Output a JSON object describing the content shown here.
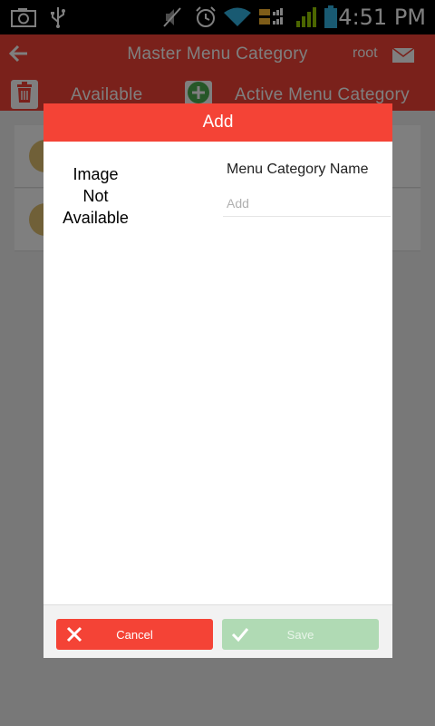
{
  "status_bar": {
    "time": "4:51 PM",
    "icons": [
      "camera-icon",
      "usb-icon",
      "mute-icon",
      "alarm-icon",
      "wifi-icon",
      "evdo-icon",
      "signal-icon",
      "battery-icon"
    ]
  },
  "app_bar": {
    "title": "Master Menu Category",
    "user": "root",
    "tab_available": "Available",
    "tab_active": "Active Menu Category"
  },
  "dialog": {
    "title": "Add",
    "image_placeholder": "Image\nNot\nAvailable",
    "field_label": "Menu Category Name",
    "field_placeholder": "Add",
    "field_value": "",
    "cancel_label": "Cancel",
    "save_label": "Save"
  },
  "colors": {
    "primary": "#f44336",
    "save_disabled": "#b0dab4",
    "add_green": "#4caf50"
  }
}
